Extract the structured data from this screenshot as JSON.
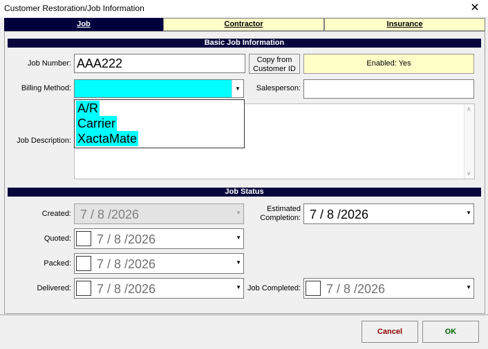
{
  "window": {
    "title": "Customer Restoration/Job Information",
    "close_glyph": "✕"
  },
  "tabs": [
    {
      "label": "Job",
      "active": true
    },
    {
      "label": "Contractor",
      "active": false
    },
    {
      "label": "Insurance",
      "active": false
    }
  ],
  "basic": {
    "section_title": "Basic Job Information",
    "job_number_label": "Job Number:",
    "job_number_value": "AAA222",
    "copy_button_line1": "Copy from",
    "copy_button_line2": "Customer ID",
    "enabled_text": "Enabled: Yes",
    "billing_label": "Billing Method:",
    "billing_value": "",
    "billing_options": [
      "A/R",
      "Carrier",
      "XactaMate"
    ],
    "salesperson_label": "Salesperson:",
    "salesperson_value": "",
    "description_label": "Job Description:",
    "description_value": ""
  },
  "status": {
    "section_title": "Job Status",
    "created_label": "Created:",
    "created_date": "7 / 8 /2026",
    "quoted_label": "Quoted:",
    "quoted_date": "7 / 8 /2026",
    "packed_label": "Packed:",
    "packed_date": "7 / 8 /2026",
    "delivered_label": "Delivered:",
    "delivered_date": "7 / 8 /2026",
    "estimated_label_line1": "Estimated",
    "estimated_label_line2": "Completion:",
    "estimated_date": "7 / 8 /2026",
    "completed_label": "Job Completed:",
    "completed_date": "7 / 8 /2026"
  },
  "footer": {
    "cancel_label": "Cancel",
    "ok_label": "OK"
  },
  "colors": {
    "accent_bar": "#07073d",
    "tab_inactive": "#ffffc8",
    "highlight": "#00ffff",
    "cancel_text": "#8b0000",
    "ok_text": "#006400"
  },
  "icons": {
    "dropdown": "chevron-down-icon",
    "close": "close-icon"
  }
}
